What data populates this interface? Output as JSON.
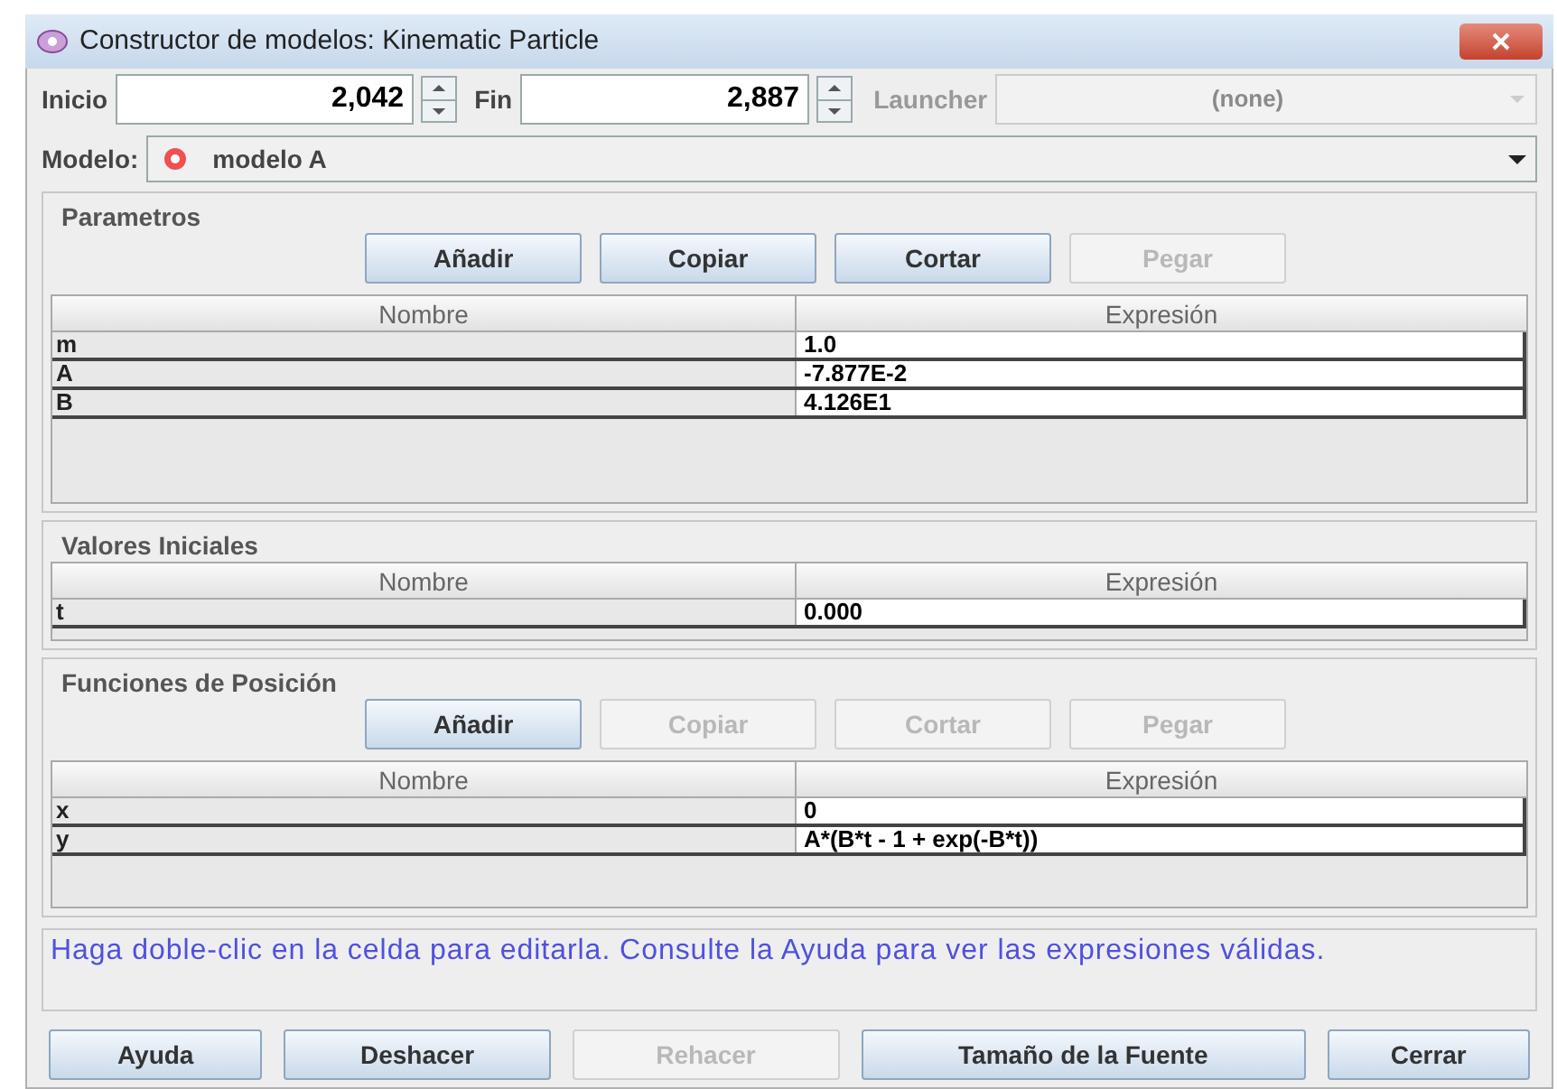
{
  "window": {
    "title": "Constructor de modelos: Kinematic Particle"
  },
  "range": {
    "start_label": "Inicio",
    "start_value": "2,042",
    "end_label": "Fin",
    "end_value": "2,887",
    "launcher_label": "Launcher",
    "launcher_value": "(none)",
    "launcher_disabled": true
  },
  "model": {
    "label": "Modelo:",
    "value": "modelo A"
  },
  "sections": [
    {
      "title": "Parametros",
      "buttons": [
        {
          "label": "Añadir",
          "disabled": false
        },
        {
          "label": "Copiar",
          "disabled": false
        },
        {
          "label": "Cortar",
          "disabled": false
        },
        {
          "label": "Pegar",
          "disabled": true
        }
      ],
      "columns": [
        "Nombre",
        "Expresión"
      ],
      "rows": [
        {
          "name": "m",
          "expression": "1.0"
        },
        {
          "name": "A",
          "expression": "-7.877E-2"
        },
        {
          "name": "B",
          "expression": "4.126E1"
        }
      ]
    },
    {
      "title": "Valores Iniciales",
      "columns": [
        "Nombre",
        "Expresión"
      ],
      "rows": [
        {
          "name": "t",
          "expression": "0.000"
        }
      ]
    },
    {
      "title": "Funciones de Posición",
      "buttons": [
        {
          "label": "Añadir",
          "disabled": false
        },
        {
          "label": "Copiar",
          "disabled": true
        },
        {
          "label": "Cortar",
          "disabled": true
        },
        {
          "label": "Pegar",
          "disabled": true
        }
      ],
      "columns": [
        "Nombre",
        "Expresión"
      ],
      "rows": [
        {
          "name": "x",
          "expression": "0"
        },
        {
          "name": "y",
          "expression": "A*(B*t - 1 + exp(-B*t))"
        }
      ]
    }
  ],
  "hint": "Haga doble-clic en la celda para editarla. Consulte la Ayuda para ver las expresiones válidas.",
  "footer_buttons": [
    {
      "label": "Ayuda",
      "disabled": false
    },
    {
      "label": "Deshacer",
      "disabled": false
    },
    {
      "label": "Rehacer",
      "disabled": true
    },
    {
      "label": "Tamaño de la Fuente",
      "disabled": false
    },
    {
      "label": "Cerrar",
      "disabled": false
    }
  ]
}
